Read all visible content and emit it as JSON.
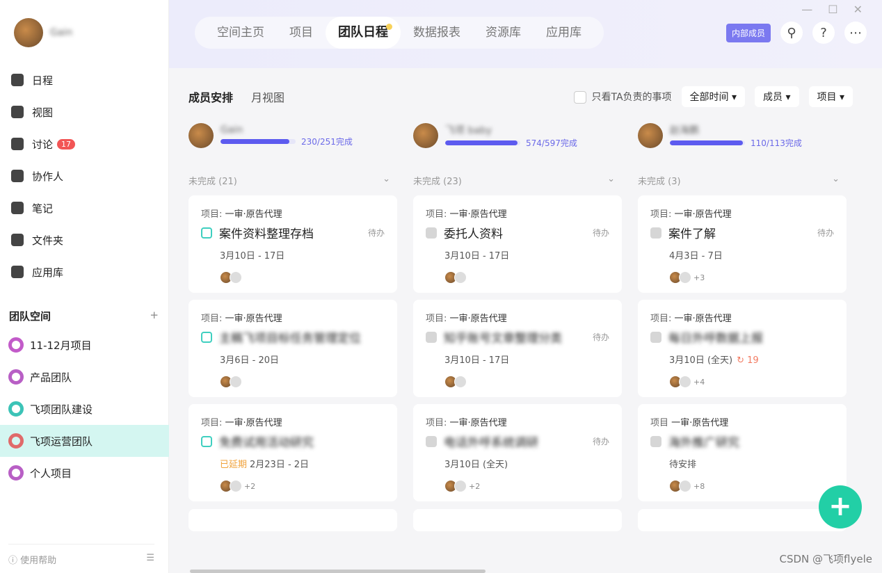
{
  "user": {
    "name": "Gain"
  },
  "nav": [
    {
      "label": "日程",
      "icon": "calendar-icon"
    },
    {
      "label": "视图",
      "icon": "chart-icon"
    },
    {
      "label": "讨论",
      "icon": "chat-icon",
      "badge": "17"
    },
    {
      "label": "协作人",
      "icon": "people-icon"
    },
    {
      "label": "笔记",
      "icon": "note-icon"
    },
    {
      "label": "文件夹",
      "icon": "folder-icon"
    },
    {
      "label": "应用库",
      "icon": "apps-icon"
    }
  ],
  "team_space": {
    "title": "团队空间",
    "add": "+",
    "items": [
      {
        "label": "11-12月项目",
        "color": "#c25bc9"
      },
      {
        "label": "产品团队",
        "color": "#b85fc5"
      },
      {
        "label": "飞项团队建设",
        "color": "#3cc3b7"
      },
      {
        "label": "飞项运营团队",
        "color": "#e06a6a"
      },
      {
        "label": "个人项目",
        "color": "#b85fc5"
      }
    ]
  },
  "footer": {
    "help": "使用帮助"
  },
  "tabs": [
    "空间主页",
    "项目",
    "团队日程",
    "数据报表",
    "资源库",
    "应用库"
  ],
  "header": {
    "member_badge": "内部成员",
    "search": "⚲",
    "help": "?",
    "more": "⋯"
  },
  "subtabs": [
    "成员安排",
    "月视图"
  ],
  "filters": {
    "only_mine": "只看TA负责的事项",
    "time": "全部时间",
    "member": "成员",
    "project": "项目"
  },
  "columns": [
    {
      "name": "Gain",
      "progress": "230/251完成",
      "pct": 91.6,
      "group": "未完成 (21)",
      "cards": [
        {
          "project_label": "项目:",
          "project": "一审·原告代理",
          "title": "案件资料整理存档",
          "blur": false,
          "status": "待办",
          "date": "3月10日 - 17日",
          "more": ""
        },
        {
          "project_label": "项目:",
          "project": "一审·原告代理",
          "title": "主稿飞项目标任务管理定位",
          "blur": true,
          "status": "",
          "date": "3月6日 - 20日",
          "more": ""
        },
        {
          "project_label": "项目:",
          "project": "一审·原告代理",
          "title": "免费试用活动研究",
          "blur": true,
          "status": "",
          "late": "已延期",
          "date": "2月23日 - 2日",
          "more": "+2"
        }
      ]
    },
    {
      "name": "飞项 baby",
      "progress": "574/597完成",
      "pct": 96.1,
      "group": "未完成 (23)",
      "cards": [
        {
          "project_label": "项目:",
          "project": "一审·原告代理",
          "title": "委托人资料",
          "blur": false,
          "status": "待办",
          "date": "3月10日 - 17日",
          "more": ""
        },
        {
          "project_label": "项目:",
          "project": "一审·原告代理",
          "title": "知乎账号文章整理分类",
          "blur": true,
          "status": "待办",
          "date": "3月10日 - 17日",
          "more": ""
        },
        {
          "project_label": "项目:",
          "project": "一审·原告代理",
          "title": "电话外呼系统调研",
          "blur": true,
          "status": "待办",
          "date": "3月10日 (全天)",
          "more": "+2"
        }
      ]
    },
    {
      "name": "赵海鹏",
      "progress": "110/113完成",
      "pct": 97.3,
      "group": "未完成 (3)",
      "cards": [
        {
          "project_label": "项目:",
          "project": "一审·原告代理",
          "title": "案件了解",
          "blur": false,
          "status": "待办",
          "date": "4月3日 - 7日",
          "more": "+3"
        },
        {
          "project_label": "项目:",
          "project": "一审·原告代理",
          "title": "每日外呼数据上报",
          "blur": true,
          "status": "",
          "date": "3月10日 (全天)",
          "repeat": "↻ 19",
          "more": "+4"
        },
        {
          "project_label": "项目",
          "project": "一审·原告代理",
          "title": "海外推广研究",
          "blur": true,
          "status": "",
          "date": "待安排",
          "more": "+8"
        }
      ]
    }
  ],
  "watermark": "CSDN @飞项flyele",
  "fab": "+"
}
